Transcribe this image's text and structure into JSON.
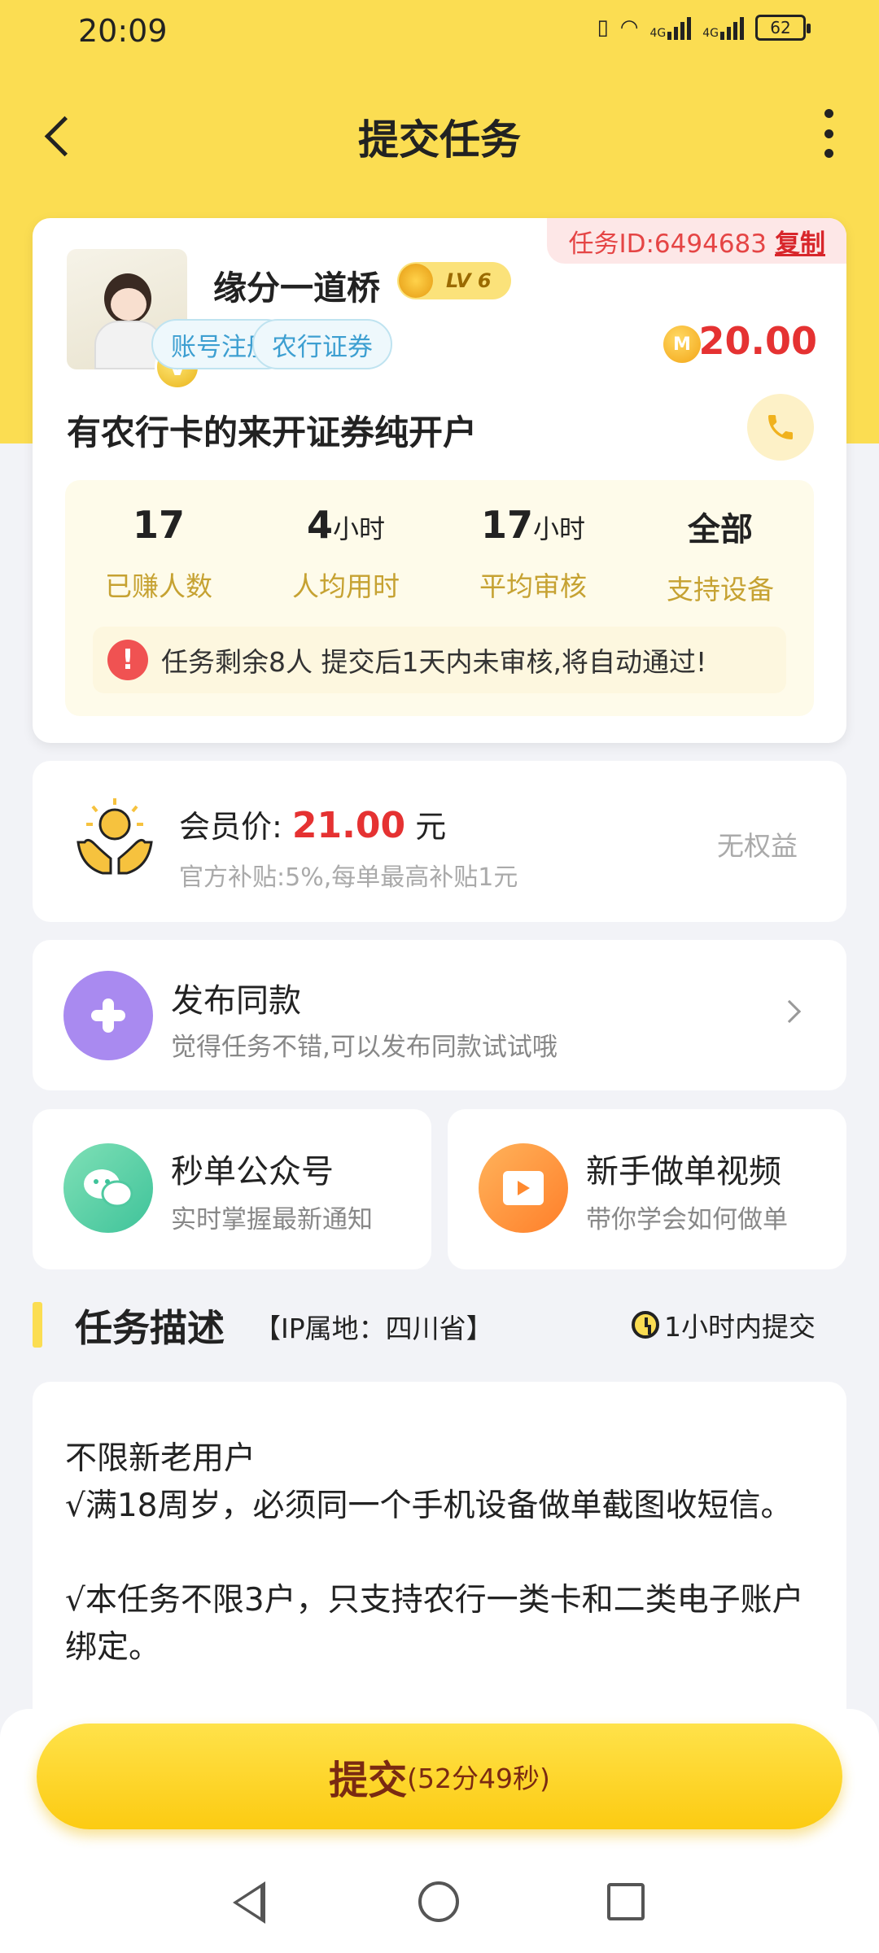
{
  "status_bar": {
    "time": "20:09",
    "battery": "62",
    "net1": "4G",
    "net2": "4G"
  },
  "header": {
    "title": "提交任务"
  },
  "task": {
    "id_label": "任务ID:6494683",
    "copy_label": "复制",
    "username": "缘分一道桥",
    "level": "LV 6",
    "vip_mark": "V",
    "tags": [
      "账号注册",
      "农行证券"
    ],
    "coin_mark": "M",
    "reward": "20.00",
    "title": "有农行卡的来开证券纯开户",
    "stats": [
      {
        "value": "17",
        "unit": "",
        "label": "已赚人数"
      },
      {
        "value": "4",
        "unit": "小时",
        "label": "人均用时"
      },
      {
        "value": "17",
        "unit": "小时",
        "label": "平均审核"
      },
      {
        "value": "全部",
        "unit": "",
        "label": "支持设备"
      }
    ],
    "notice_icon": "!",
    "notice": "任务剩余8人  提交后1天内未审核,将自动通过!"
  },
  "member": {
    "label": "会员价:",
    "price": "21.00",
    "unit": "元",
    "sub": "官方补贴:5%,每单最高补贴1元",
    "right": "无权益"
  },
  "publish": {
    "title": "发布同款",
    "sub": "觉得任务不错,可以发布同款试试哦"
  },
  "cards": [
    {
      "title": "秒单公众号",
      "sub": "实时掌握最新通知"
    },
    {
      "title": "新手做单视频",
      "sub": "带你学会如何做单"
    }
  ],
  "description": {
    "title": "任务描述",
    "ip": "【IP属地：四川省】",
    "time": "1小时内提交",
    "lines": [
      "不限新老用户",
      "√满18周岁，必须同一个手机设备做单截图收短信。",
      "",
      "√本任务不限3户，只支持农行一类卡和二类电子账户绑定。"
    ]
  },
  "submit": {
    "label": "提交",
    "timer": "(52分49秒)"
  },
  "colors": {
    "brand_yellow": "#fbdd52",
    "price_red": "#e53232",
    "tag_blue": "#3d9fd1"
  }
}
